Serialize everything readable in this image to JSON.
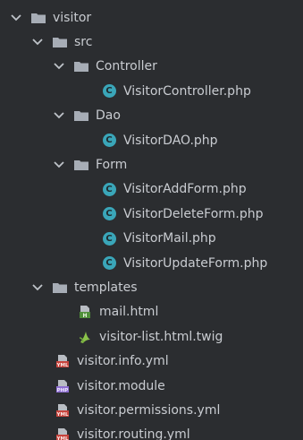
{
  "tree": {
    "root": {
      "label": "visitor"
    },
    "src": {
      "label": "src"
    },
    "controller_folder": {
      "label": "Controller"
    },
    "controller_file": {
      "label": "VisitorController.php"
    },
    "dao_folder": {
      "label": "Dao"
    },
    "dao_file": {
      "label": "VisitorDAO.php"
    },
    "form_folder": {
      "label": "Form"
    },
    "form_files": [
      {
        "label": "VisitorAddForm.php"
      },
      {
        "label": "VisitorDeleteForm.php"
      },
      {
        "label": "VisitorMail.php"
      },
      {
        "label": "VisitorUpdateForm.php"
      }
    ],
    "templates_folder": {
      "label": "templates"
    },
    "templates_files": [
      {
        "label": "mail.html"
      },
      {
        "label": "visitor-list.html.twig"
      }
    ],
    "root_files": [
      {
        "label": "visitor.info.yml"
      },
      {
        "label": "visitor.module"
      },
      {
        "label": "visitor.permissions.yml"
      },
      {
        "label": "visitor.routing.yml"
      }
    ]
  },
  "colors": {
    "background": "#2b2d30",
    "text": "#c9ccd1",
    "folder": "#a7adb6",
    "php_class": "#3aa6b9",
    "twig": "#8bc34a",
    "yml": "#c7443d",
    "php_file": "#8e6fd1"
  },
  "icons": {
    "expand": "chevron-down-icon",
    "folder": "folder-icon",
    "php_class": "php-class-icon",
    "html": "html-file-icon",
    "twig": "twig-file-icon",
    "yml": "yml-file-icon",
    "php_module": "php-file-icon"
  }
}
